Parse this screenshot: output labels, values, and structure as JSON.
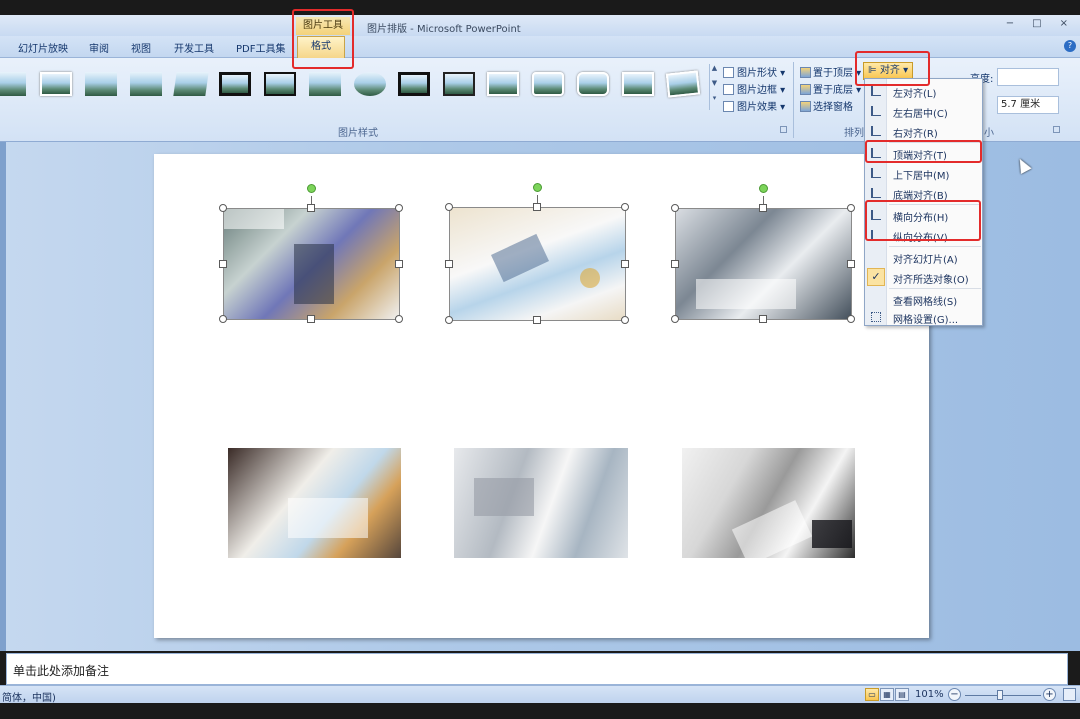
{
  "app": {
    "title": "图片排版 - Microsoft PowerPoint",
    "context_tools_label": "图片工具",
    "window_buttons": [
      "−",
      "□",
      "×"
    ]
  },
  "tabs": [
    {
      "label": "幻灯片放映"
    },
    {
      "label": "审阅"
    },
    {
      "label": "视图"
    },
    {
      "label": "开发工具"
    },
    {
      "label": "PDF工具集"
    }
  ],
  "active_tab": "格式",
  "ribbon": {
    "picture_styles_label": "图片样式",
    "picture_commands": {
      "shape": "图片形状",
      "border": "图片边框",
      "effects": "图片效果"
    },
    "arrange": {
      "bring_front": "置于顶层",
      "send_back": "置于底层",
      "selection_pane": "选择窗格",
      "align_button": "对齐",
      "group_label_partial": "排列"
    },
    "size": {
      "height_label": "高度:",
      "width_label": "度:",
      "width_value": "5.7 厘米",
      "group_label_partial": "小"
    }
  },
  "align_menu": {
    "items": [
      {
        "label": "左对齐(L)",
        "icon": "align-left-icon"
      },
      {
        "label": "左右居中(C)",
        "icon": "align-center-icon"
      },
      {
        "label": "右对齐(R)",
        "icon": "align-right-icon"
      },
      {
        "label": "顶端对齐(T)",
        "icon": "align-top-icon"
      },
      {
        "label": "上下居中(M)",
        "icon": "align-middle-icon"
      },
      {
        "label": "底端对齐(B)",
        "icon": "align-bottom-icon"
      },
      {
        "label": "横向分布(H)",
        "icon": "distribute-horizontal-icon"
      },
      {
        "label": "纵向分布(V)",
        "icon": "distribute-vertical-icon"
      },
      {
        "label": "对齐幻灯片(A)",
        "icon": ""
      },
      {
        "label": "对齐所选对象(O)",
        "icon": "check-icon",
        "checked": true
      },
      {
        "label": "查看网格线(S)",
        "icon": ""
      },
      {
        "label": "网格设置(G)...",
        "icon": "grid-icon"
      }
    ],
    "check_glyph": "✓"
  },
  "notes_placeholder": "单击此处添加备注",
  "status": {
    "language": "简体，中国)",
    "zoom_percent": "101%",
    "zoom_minus": "−",
    "zoom_plus": "+"
  }
}
